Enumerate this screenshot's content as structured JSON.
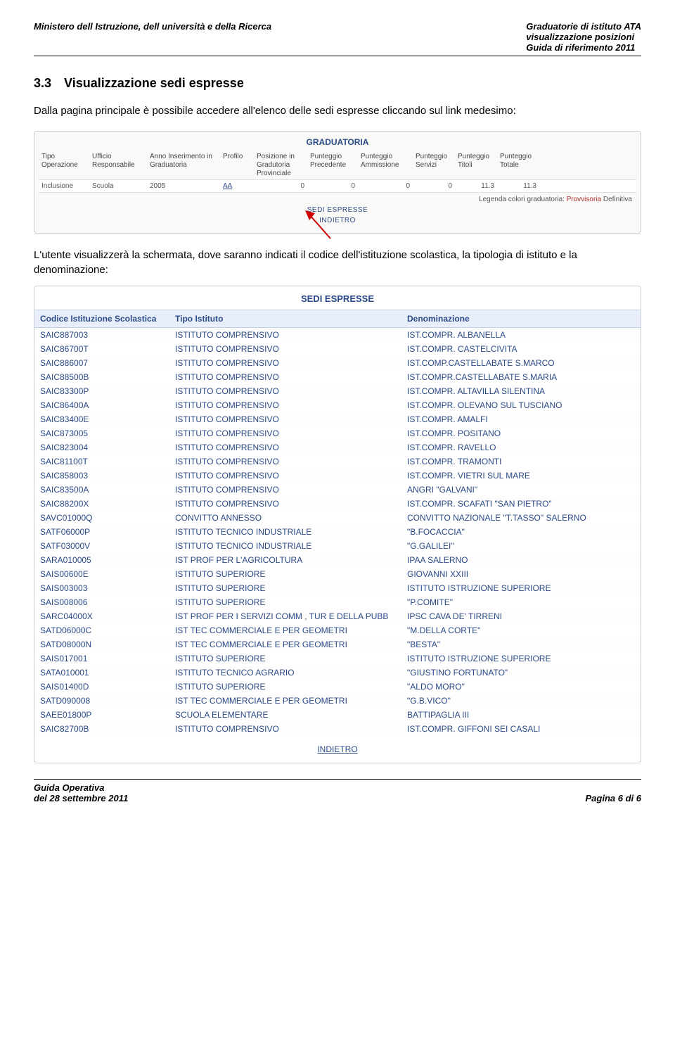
{
  "header": {
    "left": "Ministero dell Istruzione, dell università e della Ricerca",
    "right1": "Graduatorie di istituto ATA",
    "right2": "visualizzazione posizioni",
    "right3": "Guida di riferimento 2011"
  },
  "section": {
    "num": "3.3",
    "title": "Visualizzazione sedi espresse",
    "intro": "Dalla pagina principale è possibile accedere all'elenco delle sedi espresse cliccando sul link medesimo:",
    "followup": "L'utente visualizzerà la schermata, dove saranno indicati il codice dell'istituzione scolastica, la tipologia di istituto e la denominazione:"
  },
  "gradpanel": {
    "title": "GRADUATORIA",
    "headers": [
      "Tipo Operazione",
      "Ufficio Responsabile",
      "Anno Inserimento in Graduatoria",
      "Profilo",
      "Posizione in Gradutoria Provinciale",
      "Punteggio Precedente",
      "Punteggio Ammissione",
      "Punteggio Servizi",
      "Punteggio Titoli",
      "Punteggio Totale"
    ],
    "row": [
      "Inclusione",
      "Scuola",
      "2005",
      "AA",
      "0",
      "0",
      "0",
      "0",
      "11.3",
      "11.3"
    ],
    "legend_label": "Legenda colori graduatoria:",
    "legend_prov": "Provvisoria",
    "legend_def": "Definitiva",
    "link_sedi": "SEDI ESPRESSE",
    "link_indietro": "INDIETRO"
  },
  "sedi": {
    "title": "SEDI ESPRESSE",
    "headers": [
      "Codice Istituzione Scolastica",
      "Tipo Istituto",
      "Denominazione"
    ],
    "rows": [
      [
        "SAIC887003",
        "ISTITUTO COMPRENSIVO",
        "IST.COMPR. ALBANELLA"
      ],
      [
        "SAIC86700T",
        "ISTITUTO COMPRENSIVO",
        "IST.COMPR. CASTELCIVITA"
      ],
      [
        "SAIC886007",
        "ISTITUTO COMPRENSIVO",
        "IST.COMP.CASTELLABATE S.MARCO"
      ],
      [
        "SAIC88500B",
        "ISTITUTO COMPRENSIVO",
        "IST.COMPR.CASTELLABATE S.MARIA"
      ],
      [
        "SAIC83300P",
        "ISTITUTO COMPRENSIVO",
        "IST.COMPR. ALTAVILLA SILENTINA"
      ],
      [
        "SAIC86400A",
        "ISTITUTO COMPRENSIVO",
        "IST.COMPR. OLEVANO SUL TUSCIANO"
      ],
      [
        "SAIC83400E",
        "ISTITUTO COMPRENSIVO",
        "IST.COMPR. AMALFI"
      ],
      [
        "SAIC873005",
        "ISTITUTO COMPRENSIVO",
        "IST.COMPR. POSITANO"
      ],
      [
        "SAIC823004",
        "ISTITUTO COMPRENSIVO",
        "IST.COMPR. RAVELLO"
      ],
      [
        "SAIC81100T",
        "ISTITUTO COMPRENSIVO",
        "IST.COMPR. TRAMONTI"
      ],
      [
        "SAIC858003",
        "ISTITUTO COMPRENSIVO",
        "IST.COMPR. VIETRI SUL MARE"
      ],
      [
        "SAIC83500A",
        "ISTITUTO COMPRENSIVO",
        "ANGRI \"GALVANI\""
      ],
      [
        "SAIC88200X",
        "ISTITUTO COMPRENSIVO",
        "IST.COMPR. SCAFATI \"SAN PIETRO\""
      ],
      [
        "SAVC01000Q",
        "CONVITTO ANNESSO",
        "CONVITTO NAZIONALE \"T.TASSO\" SALERNO"
      ],
      [
        "SATF06000P",
        "ISTITUTO TECNICO INDUSTRIALE",
        "\"B.FOCACCIA\""
      ],
      [
        "SATF03000V",
        "ISTITUTO TECNICO INDUSTRIALE",
        "\"G.GALILEI\""
      ],
      [
        "SARA010005",
        "IST PROF PER L'AGRICOLTURA",
        "IPAA SALERNO"
      ],
      [
        "SAIS00600E",
        "ISTITUTO SUPERIORE",
        "GIOVANNI XXIII"
      ],
      [
        "SAIS003003",
        "ISTITUTO SUPERIORE",
        "ISTITUTO ISTRUZIONE SUPERIORE"
      ],
      [
        "SAIS008006",
        "ISTITUTO SUPERIORE",
        "\"P.COMITE\""
      ],
      [
        "SARC04000X",
        "IST PROF PER I SERVIZI COMM , TUR E DELLA PUBB",
        "IPSC CAVA DE' TIRRENI"
      ],
      [
        "SATD06000C",
        "IST TEC COMMERCIALE E PER GEOMETRI",
        "\"M.DELLA CORTE\""
      ],
      [
        "SATD08000N",
        "IST TEC COMMERCIALE E PER GEOMETRI",
        "\"BESTA\""
      ],
      [
        "SAIS017001",
        "ISTITUTO SUPERIORE",
        "ISTITUTO ISTRUZIONE SUPERIORE"
      ],
      [
        "SATA010001",
        "ISTITUTO TECNICO AGRARIO",
        "\"GIUSTINO FORTUNATO\""
      ],
      [
        "SAIS01400D",
        "ISTITUTO SUPERIORE",
        "\"ALDO MORO\""
      ],
      [
        "SATD090008",
        "IST TEC COMMERCIALE E PER GEOMETRI",
        "\"G.B.VICO\""
      ],
      [
        "SAEE01800P",
        "SCUOLA ELEMENTARE",
        "BATTIPAGLIA III"
      ],
      [
        "SAIC82700B",
        "ISTITUTO COMPRENSIVO",
        "IST.COMPR. GIFFONI SEI CASALI"
      ]
    ],
    "indietro": "INDIETRO"
  },
  "footer": {
    "left1": "Guida Operativa",
    "left2": "del 28 settembre 2011",
    "right": "Pagina 6 di 6"
  }
}
